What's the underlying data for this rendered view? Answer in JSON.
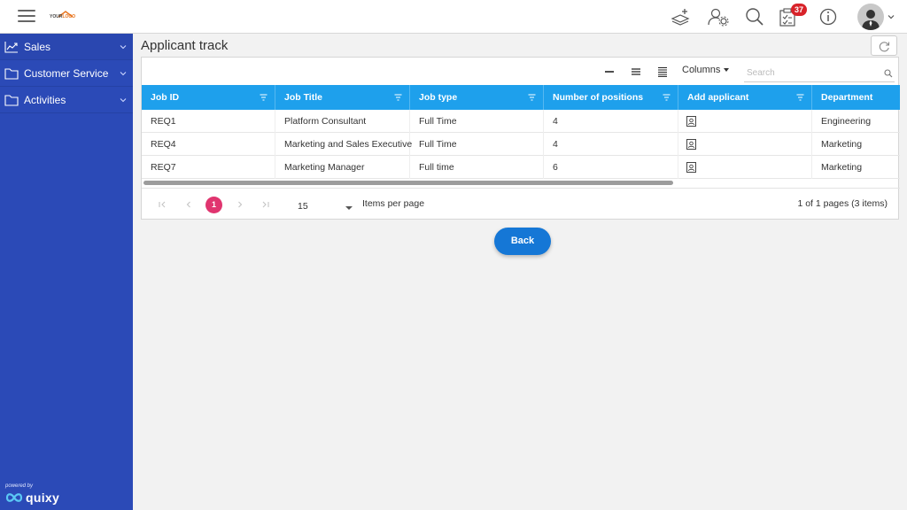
{
  "header": {
    "logo": {
      "part1": "YOUR",
      "part2": "LOGO"
    },
    "notification_count": "37",
    "icons": [
      "add-layer-icon",
      "user-settings-icon",
      "search-icon",
      "tasks-icon",
      "info-icon",
      "avatar"
    ]
  },
  "sidebar": {
    "items": [
      {
        "label": "Sales",
        "icon": "chart-line-icon"
      },
      {
        "label": "Customer Service",
        "icon": "folder-icon"
      },
      {
        "label": "Activities",
        "icon": "folder-icon"
      }
    ],
    "powered_by": "powered by",
    "brand": "quixy",
    "background": "#2b4ab7"
  },
  "page": {
    "title": "Applicant track"
  },
  "grid": {
    "columns_label": "Columns",
    "search_placeholder": "Search",
    "header_color": "#1ea0ec",
    "columns": [
      "Job ID",
      "Job Title",
      "Job type",
      "Number of positions",
      "Add applicant",
      "Department"
    ],
    "rows": [
      {
        "job_id": "REQ1",
        "job_title": "Platform Consultant",
        "job_type": "Full Time",
        "positions": "4",
        "department": "Engineering"
      },
      {
        "job_id": "REQ4",
        "job_title": "Marketing and Sales Executive",
        "job_type": "Full Time",
        "positions": "4",
        "department": "Marketing"
      },
      {
        "job_id": "REQ7",
        "job_title": "Marketing Manager",
        "job_type": "Full time",
        "positions": "6",
        "department": "Marketing"
      }
    ],
    "pager": {
      "current_page": "1",
      "page_size": "15",
      "items_per_page_label": "Items per page",
      "info": "1 of 1 pages (3 items)",
      "accent": "#e0356f"
    }
  },
  "actions": {
    "back_label": "Back",
    "back_color": "#1577d6"
  }
}
